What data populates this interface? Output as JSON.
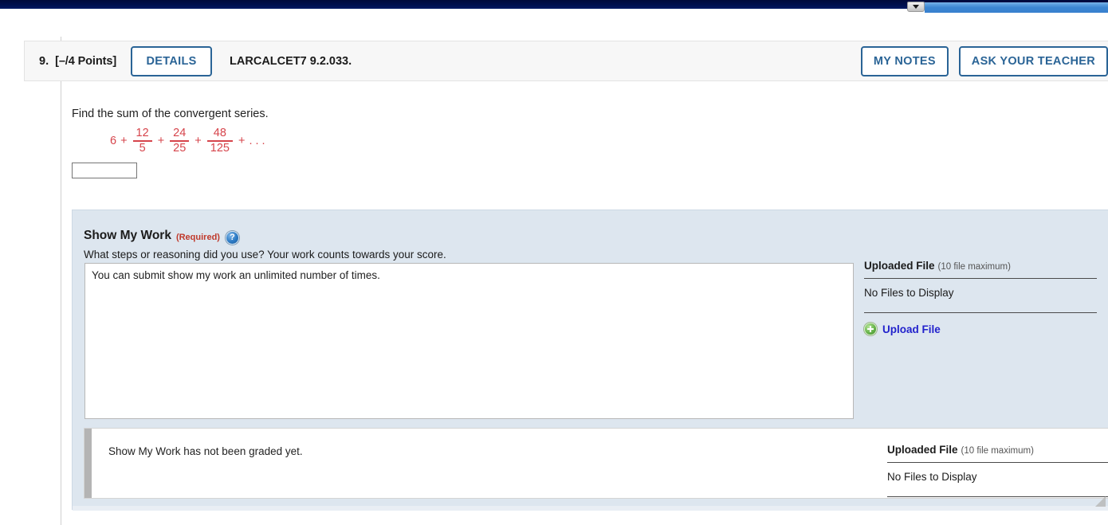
{
  "browser_chrome": {
    "dropdown_icon": "chevron-down-icon",
    "scroll_strip_color": "#3c86d2",
    "navy_bar_color": "#00104f"
  },
  "question_header": {
    "number": "9.",
    "points": "[–/4 Points]",
    "details_label": "DETAILS",
    "textbook_code": "LARCALCET7 9.2.033.",
    "my_notes_label": "MY NOTES",
    "ask_teacher_label": "ASK YOUR TEACHER",
    "accent_color": "#2a6496"
  },
  "question": {
    "prompt": "Find the sum of the convergent series.",
    "expression_color": "#d6444b",
    "series": {
      "leading_term": "6",
      "terms": [
        {
          "numerator": "12",
          "denominator": "5"
        },
        {
          "numerator": "24",
          "denominator": "25"
        },
        {
          "numerator": "48",
          "denominator": "125"
        }
      ],
      "operator": "+",
      "ellipsis": ". . ."
    },
    "answer_value": "",
    "answer_placeholder": ""
  },
  "show_my_work": {
    "title": "Show My Work",
    "required_label": "(Required)",
    "help_icon": "help-question-icon",
    "subtitle": "What steps or reasoning did you use? Your work counts towards your score.",
    "textarea_value": "You can submit show my work an unlimited number of times.",
    "textarea_placeholder": "",
    "upload_panel": {
      "heading": "Uploaded File",
      "max_note": "(10 file maximum)",
      "empty_text": "No Files to Display",
      "upload_link": "Upload File",
      "upload_icon": "plus-circle-icon",
      "link_color": "#2222cc"
    },
    "grading": {
      "message": "Show My Work has not been graded yet.",
      "upload_panel": {
        "heading": "Uploaded File",
        "max_note": "(10 file maximum)",
        "empty_text": "No Files to Display"
      }
    },
    "panel_background": "#dde6ef",
    "resize_handle": "resize-grip-icon"
  }
}
